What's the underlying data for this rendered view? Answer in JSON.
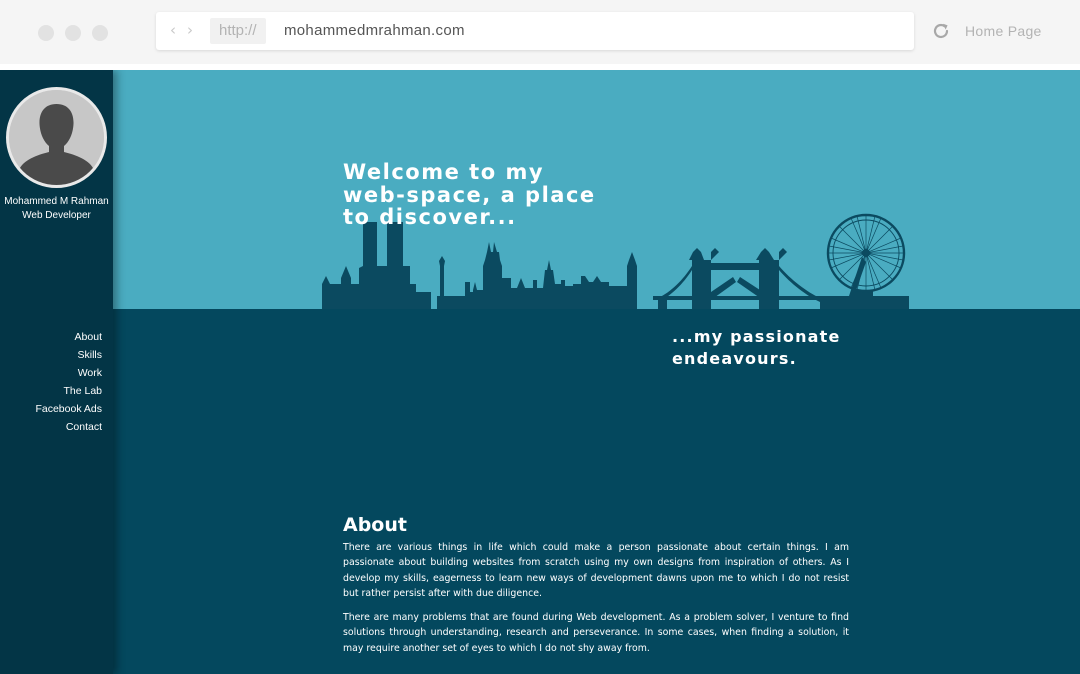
{
  "browser": {
    "protocol": "http://",
    "url": "mohammedmrahman.com",
    "home_label": "Home Page",
    "back_glyph": "‹",
    "forward_glyph": "›"
  },
  "sidebar": {
    "name": "Mohammed M Rahman",
    "role": "Web Developer",
    "menu": [
      "About",
      "Skills",
      "Work",
      "The Lab",
      "Facebook Ads",
      "Contact"
    ]
  },
  "hero": {
    "welcome_lines": [
      "Welcome to my",
      "web-space, a place",
      "to discover..."
    ],
    "passion_lines": [
      "...my passionate",
      "endeavours."
    ]
  },
  "about": {
    "title": "About",
    "p1": "There are various things in life which could make a person passionate about certain things. I am passionate about building websites from scratch using my own designs from inspiration of others. As I develop my skills, eagerness to learn new ways of development dawns upon me to which I do not resist but rather persist after with due diligence.",
    "p2": "There are many problems that are found during Web development. As a problem solver, I venture to find solutions through understanding, research and perseverance. In some cases, when finding a solution, it may require another set of eyes to which I do not shy away from."
  },
  "colors": {
    "sky": "#4aacc1",
    "ground": "#04485e",
    "sidebar": "#033546",
    "skyline": "#0b4a60"
  },
  "icons": [
    "back-arrow-icon",
    "forward-arrow-icon",
    "reload-icon",
    "avatar-silhouette-icon",
    "london-skyline"
  ]
}
